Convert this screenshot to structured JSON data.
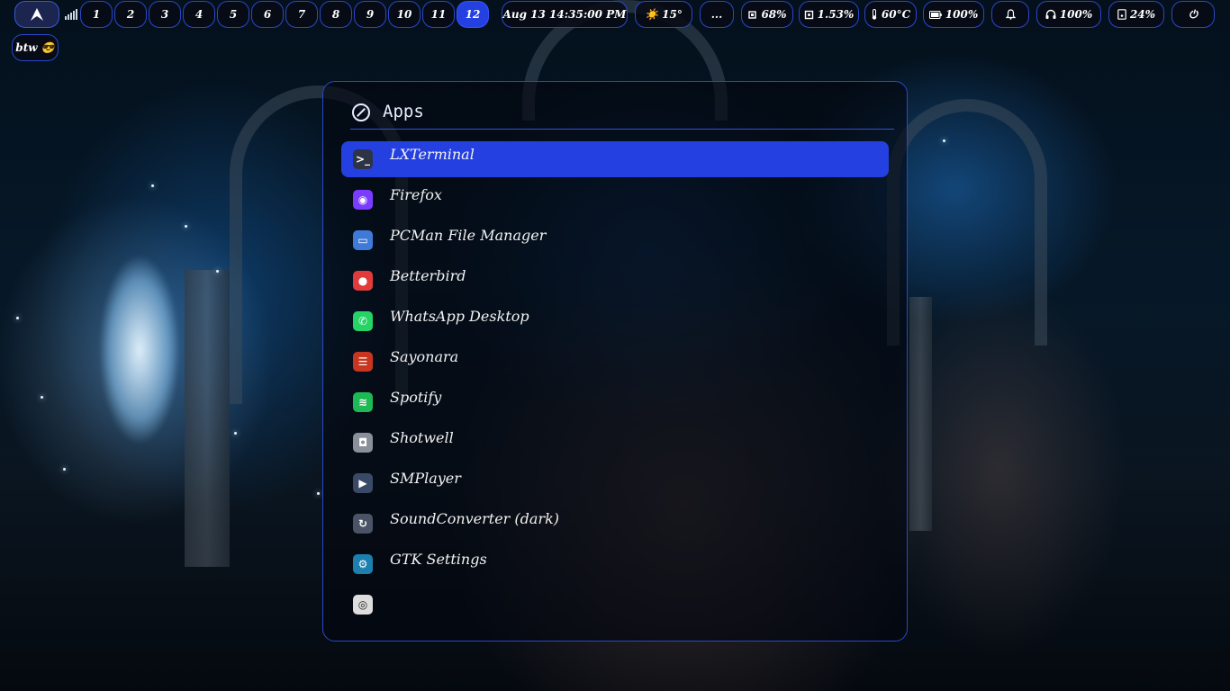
{
  "topbar": {
    "workspaces": [
      "1",
      "2",
      "3",
      "4",
      "5",
      "6",
      "7",
      "8",
      "9",
      "10",
      "11",
      "12"
    ],
    "active_workspace": "12",
    "clock": "Aug 13 14:35:00 PM",
    "weather": {
      "icon": "☀️",
      "temp": "15°"
    },
    "more": "...",
    "cpu": "68%",
    "memory": "1.53%",
    "temperature": "60°C",
    "battery": "100%",
    "headphones": "100%",
    "disk": "24%",
    "power_icon": "⏻",
    "tag": "btw 😎"
  },
  "launcher": {
    "title": "Apps",
    "apps": [
      {
        "label": "LXTerminal",
        "icon": "terminal-icon",
        "color": "#2d3446",
        "glyph": ">_"
      },
      {
        "label": "Firefox",
        "icon": "firefox-icon",
        "color": "#7b3cff",
        "glyph": "◉"
      },
      {
        "label": "PCMan File Manager",
        "icon": "folder-icon",
        "color": "#3f7ad8",
        "glyph": "▭"
      },
      {
        "label": "Betterbird",
        "icon": "betterbird-icon",
        "color": "#e23b3b",
        "glyph": "●"
      },
      {
        "label": "WhatsApp Desktop",
        "icon": "whatsapp-icon",
        "color": "#25d366",
        "glyph": "✆"
      },
      {
        "label": "Sayonara",
        "icon": "sayonara-icon",
        "color": "#c8361f",
        "glyph": "☰"
      },
      {
        "label": "Spotify",
        "icon": "spotify-icon",
        "color": "#1db954",
        "glyph": "≋"
      },
      {
        "label": "Shotwell",
        "icon": "camera-icon",
        "color": "#8a8f99",
        "glyph": "◘"
      },
      {
        "label": "SMPlayer",
        "icon": "smplayer-icon",
        "color": "#3a4a66",
        "glyph": "▶"
      },
      {
        "label": "SoundConverter (dark)",
        "icon": "soundconverter-icon",
        "color": "#4a5466",
        "glyph": "↻"
      },
      {
        "label": "GTK Settings",
        "icon": "gtk-settings-icon",
        "color": "#1b7fb0",
        "glyph": "⚙"
      },
      {
        "label": "",
        "icon": "disc-icon",
        "color": "#dddddd",
        "glyph": "◎"
      }
    ]
  }
}
